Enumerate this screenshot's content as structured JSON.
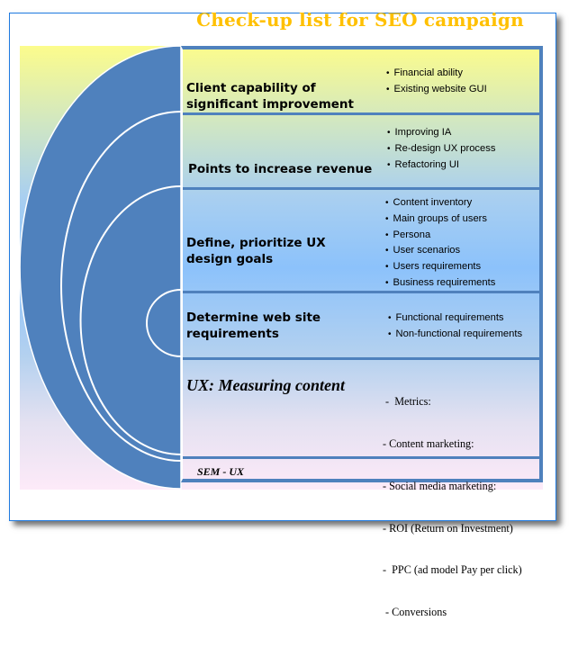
{
  "title": "Check-up list for SEO campaign",
  "colors": {
    "title": "#ffc000",
    "arc_fill": "#4f81bd",
    "frame_border": "#1f7ae0",
    "table_border": "#4f81bd"
  },
  "rows": [
    {
      "title": "Client capability of significant improvement",
      "items": [
        "Financial ability",
        "Existing website GUI"
      ]
    },
    {
      "title": "Points to increase revenue",
      "items": [
        "Improving IA",
        "Re-design UX process",
        "Refactoring UI"
      ]
    },
    {
      "title": "Define, prioritize UX design goals",
      "items": [
        "Content  inventory",
        "Main groups of users",
        "Persona",
        "User scenarios",
        "Users requirements",
        "Business requirements"
      ]
    },
    {
      "title": "Determine web site requirements",
      "items": [
        "Functional requirements",
        "Non-functional requirements"
      ]
    },
    {
      "title": "UX: Measuring content",
      "items": [
        " -  Metrics:",
        "- Content marketing:",
        "- Social media marketing:",
        "- ROI (Return on Investment)",
        "-  PPC (ad model Pay per click)",
        " - Conversions"
      ]
    },
    {
      "title": "SEM - UX",
      "items": []
    }
  ]
}
